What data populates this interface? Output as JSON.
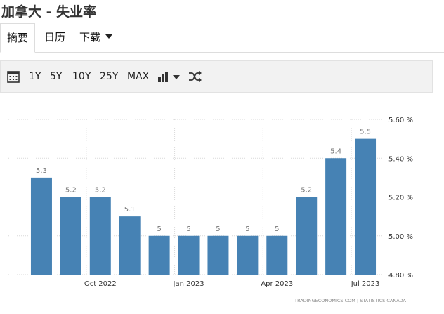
{
  "page": {
    "title": "加拿大 - 失业率"
  },
  "tabs": [
    {
      "label": "摘要"
    },
    {
      "label": "日历"
    },
    {
      "label": "下载"
    }
  ],
  "toolbar": {
    "ranges": [
      "1Y",
      "5Y",
      "10Y",
      "25Y",
      "MAX"
    ],
    "icons": [
      "calendar-icon",
      "bar-chart-icon",
      "shuffle-icon"
    ]
  },
  "footer": {
    "source": "TRADINGECONOMICS.COM  |  STATISTICS CANADA"
  },
  "colors": {
    "bar": "#4682b4",
    "grid": "#d9d9d9",
    "label": "#777777"
  },
  "chart_data": {
    "type": "bar",
    "title": "",
    "xlabel": "",
    "ylabel": "",
    "values": [
      5.3,
      5.2,
      5.2,
      5.1,
      5.0,
      5.0,
      5.0,
      5.0,
      5.0,
      5.2,
      5.4,
      5.5
    ],
    "data_labels": [
      "5.3",
      "5.2",
      "5.2",
      "5.1",
      "5",
      "5",
      "5",
      "5",
      "5",
      "5.2",
      "5.4",
      "5.5"
    ],
    "x_ticks": [
      {
        "index": 2,
        "label": "Oct 2022"
      },
      {
        "index": 5,
        "label": "Jan 2023"
      },
      {
        "index": 8,
        "label": "Apr 2023"
      },
      {
        "index": 11,
        "label": "Jul 2023"
      }
    ],
    "y_ticks": [
      {
        "value": 5.6,
        "label": "5.60 %"
      },
      {
        "value": 5.4,
        "label": "5.40 %"
      },
      {
        "value": 5.2,
        "label": "5.20 %"
      },
      {
        "value": 5.0,
        "label": "5.00 %"
      },
      {
        "value": 4.8,
        "label": "4.80 %"
      }
    ],
    "ylim": [
      4.8,
      5.6
    ],
    "y_axis_position": "right",
    "grid": true
  }
}
